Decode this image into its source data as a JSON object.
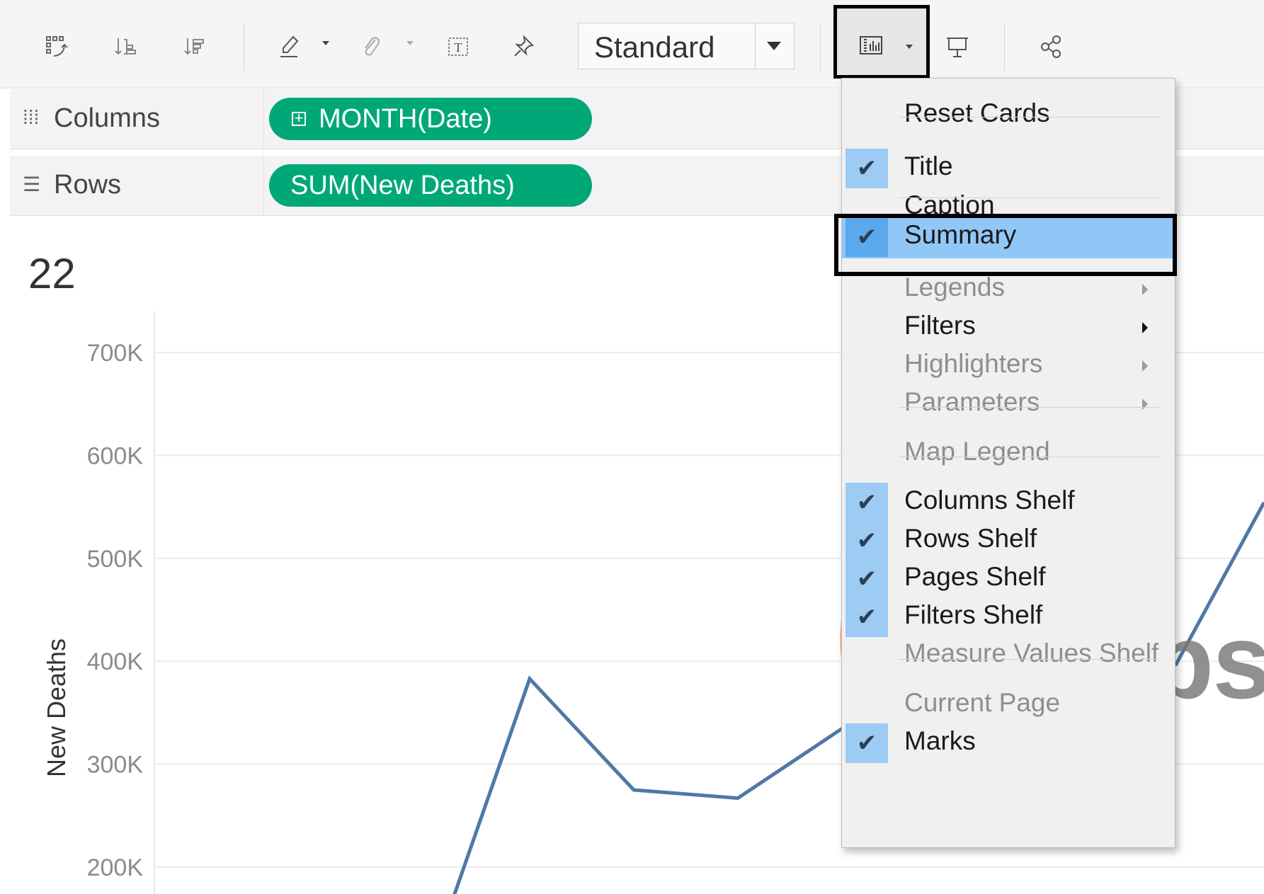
{
  "toolbar": {
    "fit_value": "Standard",
    "icons": [
      "swap-icon",
      "sort-ascending-icon",
      "sort-descending-icon",
      "highlight-icon",
      "group-paperclip-icon",
      "labels-icon",
      "pin-icon",
      "show-hide-cards-icon",
      "presentation-icon",
      "share-icon"
    ]
  },
  "shelves": {
    "columns": {
      "label": "Columns",
      "pill": "MONTH(Date)"
    },
    "rows": {
      "label": "Rows",
      "pill": "SUM(New Deaths)"
    }
  },
  "viz": {
    "title": "22"
  },
  "chart_data": {
    "type": "line",
    "ylabel": "New Deaths",
    "yticks": [
      "700K",
      "600K",
      "500K",
      "400K",
      "300K",
      "200K"
    ],
    "ylim": [
      170000,
      740000
    ],
    "series": [
      {
        "values": [
          170000,
          383000,
          275000,
          267000,
          335000
        ]
      }
    ],
    "line_color": "#4e79a7",
    "grid": true
  },
  "menu": {
    "items": [
      {
        "label": "Reset Cards",
        "checked": false,
        "disabled": false,
        "submenu": false
      },
      {
        "label": "Title",
        "checked": true,
        "disabled": false,
        "submenu": false
      },
      {
        "label": "Caption",
        "checked": false,
        "disabled": false,
        "submenu": false
      },
      {
        "label": "Summary",
        "checked": true,
        "disabled": false,
        "submenu": false,
        "highlighted": true
      },
      {
        "label": "Legends",
        "checked": false,
        "disabled": true,
        "submenu": true
      },
      {
        "label": "Filters",
        "checked": false,
        "disabled": false,
        "submenu": true
      },
      {
        "label": "Highlighters",
        "checked": false,
        "disabled": true,
        "submenu": true
      },
      {
        "label": "Parameters",
        "checked": false,
        "disabled": true,
        "submenu": true
      },
      {
        "label": "Map Legend",
        "checked": false,
        "disabled": true,
        "submenu": false
      },
      {
        "label": "Columns Shelf",
        "checked": true,
        "disabled": false,
        "submenu": false
      },
      {
        "label": "Rows Shelf",
        "checked": true,
        "disabled": false,
        "submenu": false
      },
      {
        "label": "Pages Shelf",
        "checked": true,
        "disabled": false,
        "submenu": false
      },
      {
        "label": "Filters Shelf",
        "checked": true,
        "disabled": false,
        "submenu": false
      },
      {
        "label": "Measure Values Shelf",
        "checked": false,
        "disabled": true,
        "submenu": false
      },
      {
        "label": "Current Page",
        "checked": false,
        "disabled": true,
        "submenu": false
      },
      {
        "label": "Marks",
        "checked": true,
        "disabled": false,
        "submenu": false
      }
    ]
  },
  "watermark": {
    "text": "dumps"
  },
  "colors": {
    "pill": "#00a877",
    "menu_check": "#9ccbf4",
    "menu_highlight": "#91c7f6",
    "line": "#4e79a7"
  }
}
